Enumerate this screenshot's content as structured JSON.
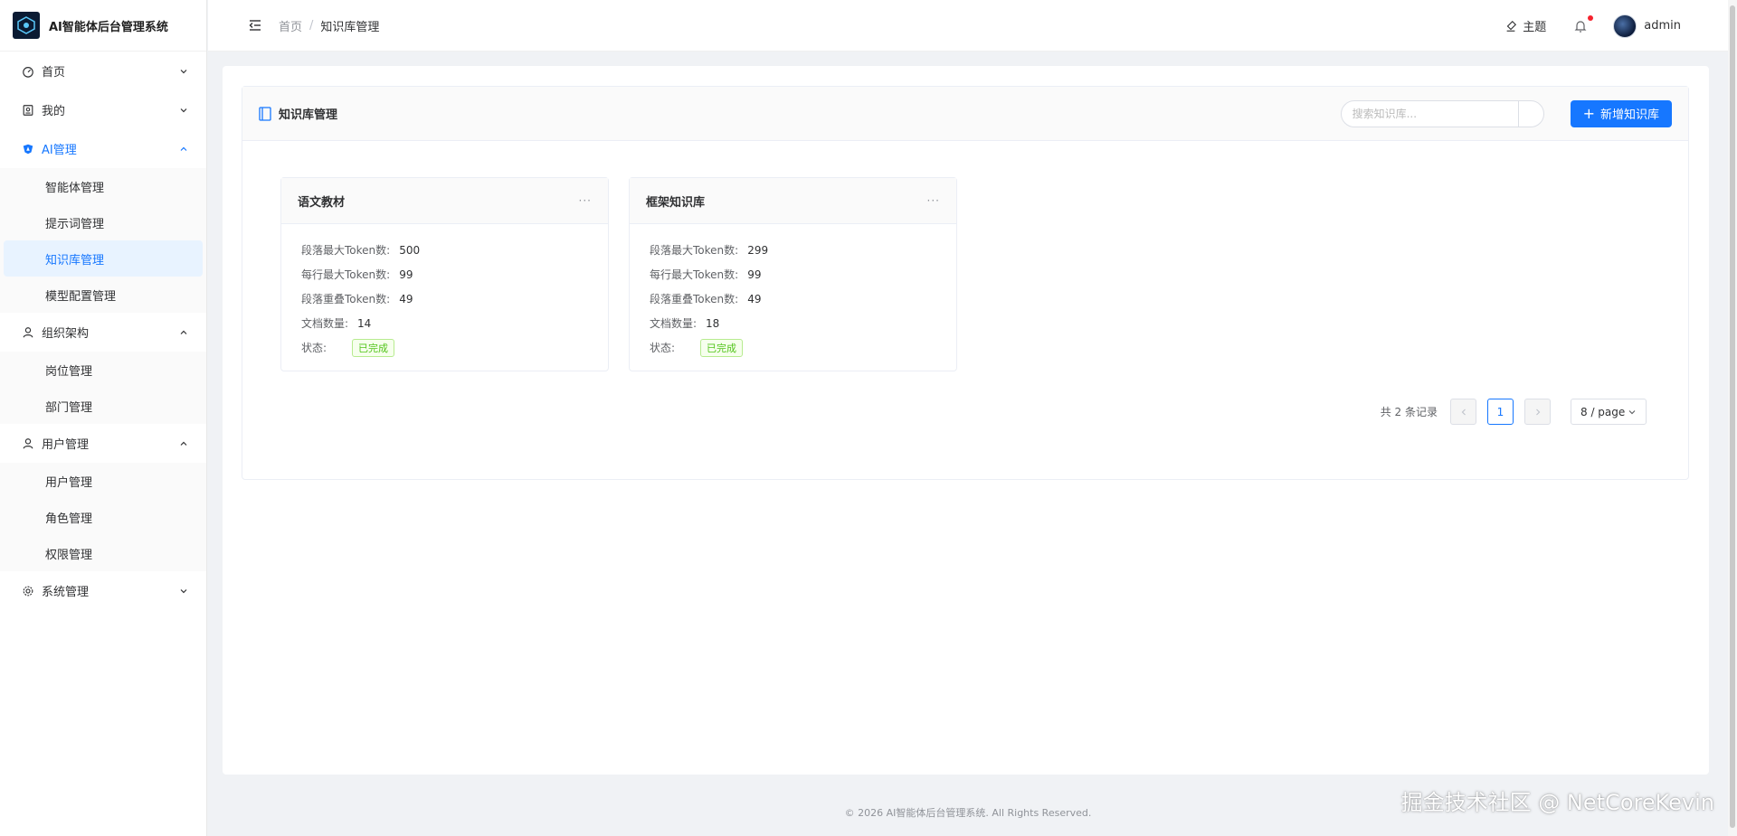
{
  "app": {
    "title": "AI智能体后台管理系统"
  },
  "sidebar": {
    "menus": [
      {
        "label": "首页",
        "icon": "dashboard-icon"
      },
      {
        "label": "我的",
        "icon": "profile-icon"
      },
      {
        "label": "AI管理",
        "icon": "ai-icon",
        "children": [
          "智能体管理",
          "提示词管理",
          "知识库管理",
          "模型配置管理"
        ]
      },
      {
        "label": "组织架构",
        "icon": "org-icon",
        "children": [
          "岗位管理",
          "部门管理"
        ]
      },
      {
        "label": "用户管理",
        "icon": "user-icon",
        "children": [
          "用户管理",
          "角色管理",
          "权限管理"
        ]
      },
      {
        "label": "系统管理",
        "icon": "settings-icon"
      }
    ]
  },
  "header": {
    "breadcrumb": {
      "home": "首页",
      "sep": "/",
      "current": "知识库管理"
    },
    "theme_label": "主题",
    "user": "admin"
  },
  "kb": {
    "title": "知识库管理",
    "search_placeholder": "搜索知识库...",
    "add_label": "新增知识库",
    "cards": [
      {
        "name": "语文教材",
        "more": "···",
        "rows": [
          {
            "label": "段落最大Token数:",
            "value": "500"
          },
          {
            "label": "每行最大Token数:",
            "value": "99"
          },
          {
            "label": "段落重叠Token数:",
            "value": "49"
          },
          {
            "label": "文档数量:",
            "value": "14"
          }
        ],
        "status_label": "状态:",
        "status": "已完成"
      },
      {
        "name": "框架知识库",
        "more": "···",
        "rows": [
          {
            "label": "段落最大Token数:",
            "value": "299"
          },
          {
            "label": "每行最大Token数:",
            "value": "99"
          },
          {
            "label": "段落重叠Token数:",
            "value": "49"
          },
          {
            "label": "文档数量:",
            "value": "18"
          }
        ],
        "status_label": "状态:",
        "status": "已完成"
      }
    ]
  },
  "pagination": {
    "total": "共 2 条记录",
    "current": "1",
    "page_size": "8 / page"
  },
  "footer": "© 2026 AI智能体后台管理系统. All Rights Reserved.",
  "watermark": "掘金技术社区 @ NetCoreKevin",
  "colors": {
    "primary": "#1677ff",
    "success": "#52c41a"
  }
}
